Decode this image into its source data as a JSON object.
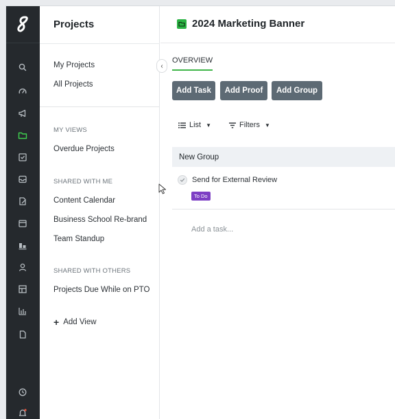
{
  "rail": {
    "logo": "logo-icon",
    "icons": [
      "search-icon",
      "dashboard-gauge-icon",
      "megaphone-icon",
      "folder-icon",
      "task-check-icon",
      "inbox-icon",
      "proof-edit-icon",
      "calendar-icon",
      "team-chart-icon",
      "user-icon",
      "grid-board-icon",
      "reports-bar-icon",
      "document-icon",
      "clock-icon",
      "notification-bell-icon"
    ],
    "active_color": "#3fd14f"
  },
  "panel": {
    "title": "Projects",
    "links": [
      "My Projects",
      "All Projects"
    ],
    "my_views_header": "MY VIEWS",
    "my_views": [
      "Overdue Projects"
    ],
    "shared_with_me_header": "SHARED WITH ME",
    "shared_with_me": [
      "Content Calendar",
      "Business School Re-brand",
      "Team Standup"
    ],
    "shared_with_others_header": "SHARED WITH OTHERS",
    "shared_with_others": [
      "Projects Due While on PTO"
    ],
    "add_view": "Add View"
  },
  "main": {
    "project_title": "2024 Marketing Banner",
    "tab": "OVERVIEW",
    "buttons": [
      "Add Task",
      "Add Proof",
      "Add Group"
    ],
    "view_dropdown": "List",
    "filters_dropdown": "Filters",
    "group_name": "New Group",
    "task": {
      "name": "Send for External Review",
      "status": "To Do",
      "status_color": "#7d3fc4"
    },
    "add_task_placeholder": "Add a task..."
  },
  "colors": {
    "rail_bg": "#25292d",
    "accent_green": "#3fb549",
    "button_bg": "#5d6a74"
  }
}
